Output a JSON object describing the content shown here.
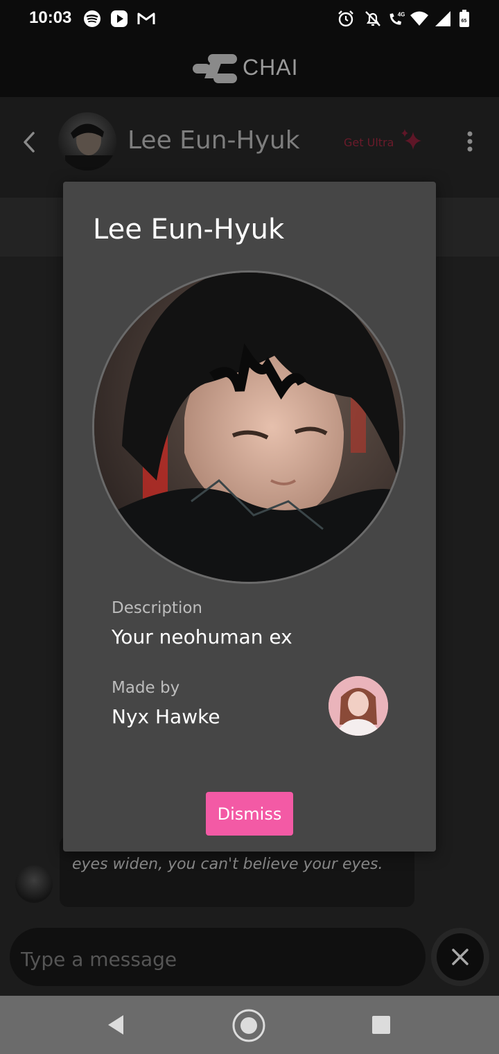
{
  "status_bar": {
    "time": "10:03",
    "left_icons": [
      "spotify-icon",
      "youtube-music-icon",
      "gmail-icon"
    ],
    "right_icons": [
      "alarm-icon",
      "bell-off-icon",
      "volte-4g-icon",
      "wifi-icon",
      "signal-icon",
      "battery-icon"
    ],
    "network_label": "4G"
  },
  "app_header": {
    "logo_text": "CHAI"
  },
  "chat_header": {
    "bot_name": "Lee Eun-Hyuk",
    "get_ultra_label": "Get Ultra"
  },
  "message": {
    "text": "eyes widen, you can't believe your eyes."
  },
  "input": {
    "placeholder": "Type a message"
  },
  "modal": {
    "title": "Lee Eun-Hyuk",
    "description_label": "Description",
    "description_value": "Your neohuman ex",
    "made_by_label": "Made by",
    "made_by_value": "Nyx Hawke",
    "dismiss_label": "Dismiss"
  },
  "colors": {
    "accent_pink": "#f35aa5",
    "modal_bg": "#464646",
    "get_ultra": "#6b1a2a"
  }
}
